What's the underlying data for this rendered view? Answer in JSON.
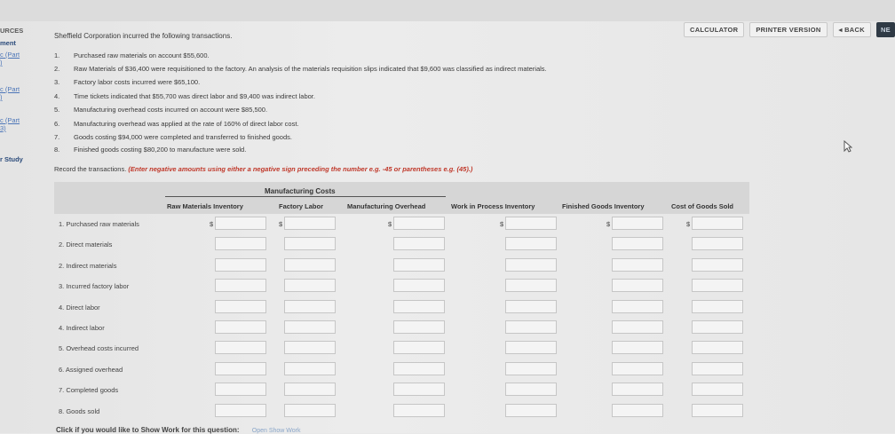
{
  "toolbar": {
    "calculator": "CALCULATOR",
    "printer_version": "PRINTER VERSION",
    "back": "◂ BACK",
    "next": "NE"
  },
  "sidebar": {
    "items": [
      {
        "label": "URCES",
        "style": "head"
      },
      {
        "label": "ment",
        "style": "bold"
      },
      {
        "label": "c (Part",
        "style": "link"
      },
      {
        "label": ")",
        "style": "link"
      },
      {
        "label": "c (Part",
        "style": "link"
      },
      {
        "label": ")",
        "style": "link"
      },
      {
        "label": "c (Part",
        "style": "link"
      },
      {
        "label": "3)",
        "style": "link"
      },
      {
        "label": "r Study",
        "style": "bold"
      }
    ]
  },
  "question": {
    "intro": "Sheffield Corporation incurred the following transactions.",
    "transactions": [
      {
        "n": "1.",
        "text": "Purchased raw materials on account $55,600."
      },
      {
        "n": "2.",
        "text": "Raw Materials of $36,400 were requisitioned to the factory. An analysis of the materials requisition slips indicated that $9,600 was classified as indirect materials."
      },
      {
        "n": "3.",
        "text": "Factory labor costs incurred were $65,100."
      },
      {
        "n": "4.",
        "text": "Time tickets indicated that $55,700 was direct labor and $9,400 was indirect labor."
      },
      {
        "n": "5.",
        "text": "Manufacturing overhead costs incurred on account were $85,500."
      },
      {
        "n": "6.",
        "text": "Manufacturing overhead was applied at the rate of 160% of direct labor cost."
      },
      {
        "n": "7.",
        "text": "Goods costing $94,000 were completed and transferred to finished goods."
      },
      {
        "n": "8.",
        "text": "Finished goods costing $80,200 to manufacture were sold."
      }
    ],
    "instruction": "Record the transactions.",
    "instruction_red": "(Enter negative amounts using either a negative sign preceding the number e.g. -45 or parentheses e.g. (45).)"
  },
  "table": {
    "group_header": "Manufacturing Costs",
    "columns": [
      "Raw Materials Inventory",
      "Factory Labor",
      "Manufacturing Overhead",
      "Work in Process Inventory",
      "Finished Goods Inventory",
      "Cost of Goods Sold"
    ],
    "currency": "$",
    "rows": [
      "1. Purchased raw materials",
      "2. Direct materials",
      "2. Indirect materials",
      "3. Incurred factory labor",
      "4. Direct labor",
      "4. Indirect labor",
      "5. Overhead costs incurred",
      "6. Assigned overhead",
      "7. Completed goods",
      "8. Goods sold"
    ]
  },
  "footer": {
    "text": "Click if you would like to Show Work for this question:",
    "link": "Open Show Work"
  }
}
